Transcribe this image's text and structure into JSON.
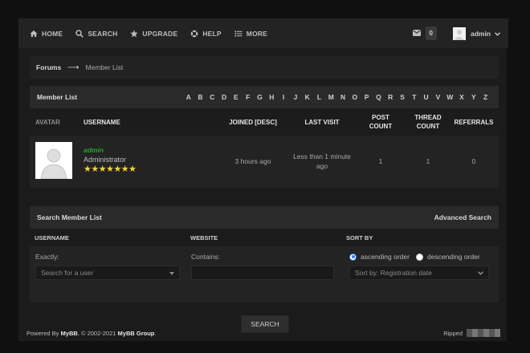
{
  "nav": {
    "items": [
      {
        "label": "HOME",
        "icon": "home-icon"
      },
      {
        "label": "SEARCH",
        "icon": "search-icon"
      },
      {
        "label": "UPGRADE",
        "icon": "star-icon"
      },
      {
        "label": "HELP",
        "icon": "help-icon"
      },
      {
        "label": "MORE",
        "icon": "list-icon"
      }
    ],
    "pm_count": "0",
    "username": "admin"
  },
  "breadcrumb": {
    "root": "Forums",
    "current": "Member List"
  },
  "member_list": {
    "title": "Member List",
    "letters": [
      "A",
      "B",
      "C",
      "D",
      "E",
      "F",
      "G",
      "H",
      "I",
      "J",
      "K",
      "L",
      "M",
      "N",
      "O",
      "P",
      "Q",
      "R",
      "S",
      "T",
      "U",
      "V",
      "W",
      "X",
      "Y",
      "Z"
    ],
    "columns": {
      "avatar": "AVATAR",
      "username": "USERNAME",
      "joined": "JOINED [DESC]",
      "last_visit": "LAST VISIT",
      "post_count": "POST COUNT",
      "thread_count": "THREAD COUNT",
      "referrals": "REFERRALS"
    },
    "rows": [
      {
        "username": "admin",
        "usertitle": "Administrator",
        "stars": "★★★★★★★",
        "joined": "3 hours ago",
        "last_visit": "Less than 1 minute ago",
        "post_count": "1",
        "thread_count": "1",
        "referrals": "0"
      }
    ]
  },
  "search": {
    "title": "Search Member List",
    "advanced": "Advanced Search",
    "headers": {
      "username": "USERNAME",
      "website": "WEBSITE",
      "sort_by": "SORT BY"
    },
    "exactly_label": "Exactly:",
    "username_placeholder": "Search for a user",
    "contains_label": "Contains:",
    "ascending": "ascending order",
    "descending": "descending order",
    "sort_selected": "Sort by: Registration date",
    "button": "SEARCH"
  },
  "footer": {
    "powered_prefix": "Powered By",
    "mybb": "MyBB",
    "copyright": ", © 2002-2021",
    "group": "MyBB Group",
    "period": ".",
    "ripped": "Ripped"
  },
  "colors": {
    "accent_user": "#1fa82b",
    "stars": "#f3d23a",
    "radio": "#2f7df0"
  }
}
